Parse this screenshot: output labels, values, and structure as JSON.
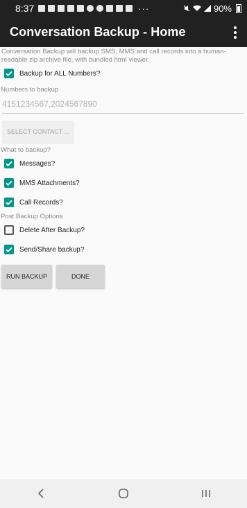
{
  "status_bar": {
    "time": "8:37",
    "overflow_dots": "···",
    "battery": "90%"
  },
  "app_bar": {
    "title": "Conversation Backup - Home"
  },
  "description": "Conversation Backup will backup SMS, MMS and call records into a human-readable zip archive file, with bundled html viewer.",
  "backup_all": {
    "label": "Backup for ALL Numbers?",
    "checked": true
  },
  "numbers": {
    "section_label": "Numbers to backup",
    "placeholder": "4151234567,2024567890",
    "select_contact_label": "SELECT CONTACT ..."
  },
  "what_to_backup": {
    "section_label": "What to backup?",
    "items": [
      {
        "label": "Messages?",
        "checked": true
      },
      {
        "label": "MMS Attachments?",
        "checked": true
      },
      {
        "label": "Call Records?",
        "checked": true
      }
    ]
  },
  "post_backup": {
    "section_label": "Post Backup Options",
    "items": [
      {
        "label": "Delete After Backup?",
        "checked": false
      },
      {
        "label": "Send/Share backup?",
        "checked": true
      }
    ]
  },
  "actions": {
    "run_label": "RUN BACKUP",
    "done_label": "DONE"
  },
  "colors": {
    "accent": "#009688",
    "app_bar": "#212121",
    "background": "#fafafa"
  },
  "icons": {
    "overflow": "more-vert-icon",
    "back": "back-icon",
    "home": "home-icon",
    "recents": "recents-icon"
  }
}
